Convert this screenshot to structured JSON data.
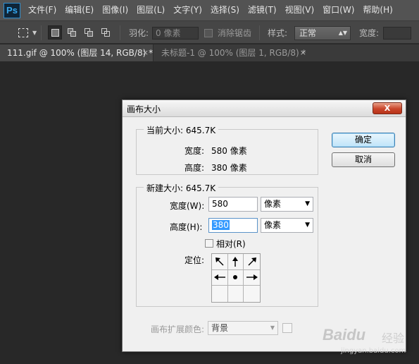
{
  "app": {
    "logo": "Ps"
  },
  "menubar": {
    "items": [
      "文件(F)",
      "编辑(E)",
      "图像(I)",
      "图层(L)",
      "文字(Y)",
      "选择(S)",
      "滤镜(T)",
      "视图(V)",
      "窗口(W)",
      "帮助(H)"
    ]
  },
  "options_bar": {
    "feather_label": "羽化:",
    "feather_value": "0 像素",
    "antialias_label": "消除锯齿",
    "style_label": "样式:",
    "style_value": "正常",
    "width_label": "宽度:"
  },
  "tabs": [
    {
      "label": "111.gif @ 100% (图层 14, RGB/8) *",
      "close": "×"
    },
    {
      "label": "未标题-1 @ 100% (图层 1, RGB/8) *",
      "close": "×"
    }
  ],
  "dialog": {
    "title": "画布大小",
    "close_glyph": "X",
    "current": {
      "legend": "当前大小: 645.7K",
      "width_label": "宽度:",
      "width_value": "580 像素",
      "height_label": "高度:",
      "height_value": "380 像素"
    },
    "new": {
      "legend": "新建大小: 645.7K",
      "width_label": "宽度(W):",
      "width_value": "580",
      "width_unit": "像素",
      "height_label": "高度(H):",
      "height_value": "380",
      "height_unit": "像素",
      "relative_label": "相对(R)",
      "anchor_label": "定位:"
    },
    "ok_label": "确定",
    "cancel_label": "取消",
    "extension_label": "画布扩展颜色:",
    "extension_value": "背景"
  },
  "watermark": {
    "logo": "Baidu",
    "cn": "经验",
    "url": "jingyan.baidu.com"
  },
  "colors": {
    "menubar": "#535353",
    "optionsbar": "#464646",
    "canvas": "#282828",
    "dialog": "#f0f0f0",
    "close": "#c9462b",
    "selection": "#3399ff"
  }
}
